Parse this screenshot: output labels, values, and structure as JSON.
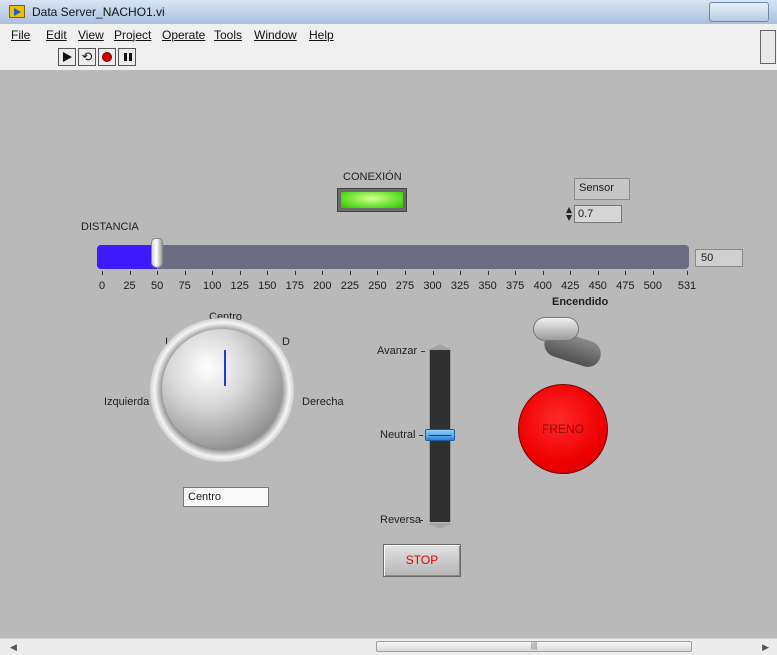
{
  "window": {
    "title": "Data Server_NACHO1.vi"
  },
  "menu": [
    "File",
    "Edit",
    "View",
    "Project",
    "Operate",
    "Tools",
    "Window",
    "Help"
  ],
  "toolbar": {
    "icons": [
      "run-arrow",
      "run-continuously",
      "abort",
      "pause"
    ],
    "run_continuously_glyph": "⟲"
  },
  "conexion": {
    "label": "CONEXIÓN",
    "state": "on",
    "color": "#55dd20"
  },
  "sensor": {
    "label": "Sensor",
    "value": "0.7"
  },
  "distancia": {
    "label": "DISTANCIA",
    "value": 50,
    "value_text": "50",
    "min": 0,
    "max": 531,
    "fill_color": "#3f1aff",
    "ticks": [
      "0",
      "25",
      "50",
      "75",
      "100",
      "125",
      "150",
      "175",
      "200",
      "225",
      "250",
      "275",
      "300",
      "325",
      "350",
      "375",
      "400",
      "425",
      "450",
      "475",
      "500",
      "531"
    ]
  },
  "direccion": {
    "labels": {
      "top": "Centro",
      "i": "I",
      "d": "D",
      "left": "Izquierda",
      "right": "Derecha"
    },
    "display": "Centro"
  },
  "marcha": {
    "labels": {
      "top": "Avanzar",
      "middle": "Neutral",
      "bottom": "Reversa"
    },
    "value": "Neutral"
  },
  "stop": {
    "label": "STOP"
  },
  "encendido": {
    "label": "Encendido",
    "state": "off"
  },
  "freno": {
    "label": "FRENO",
    "color": "#ee0000"
  },
  "scrollbar": {
    "grip": "|||"
  }
}
